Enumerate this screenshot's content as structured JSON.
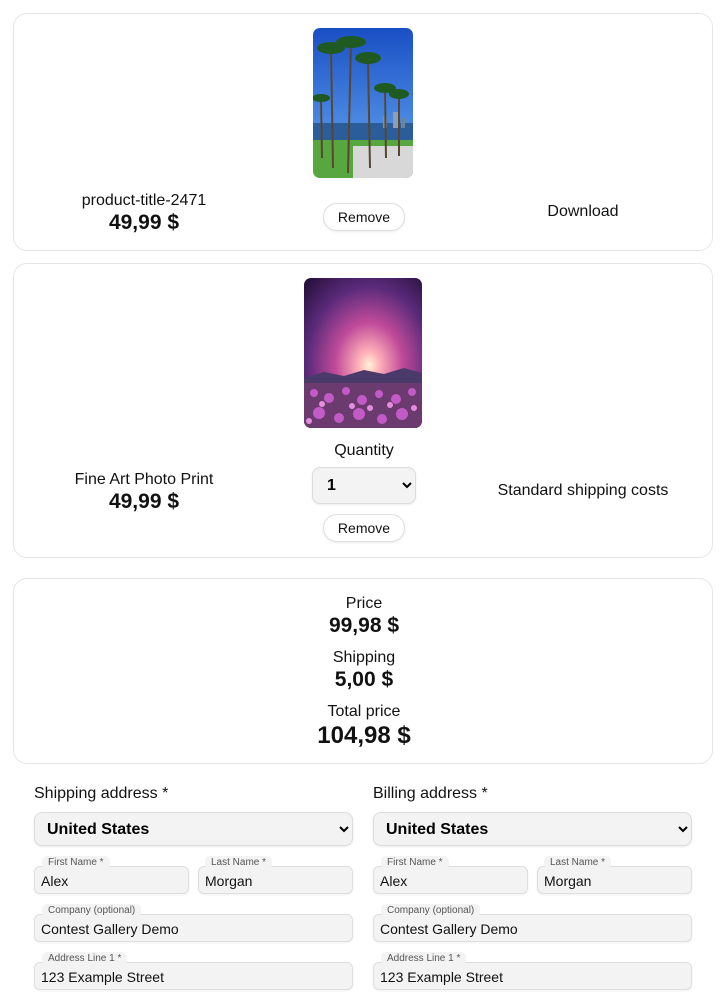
{
  "cart": {
    "items": [
      {
        "title": "product-title-2471",
        "price": "49,99 $",
        "remove_label": "Remove",
        "delivery_label": "Download",
        "image_icon": "palm-trees-photo"
      },
      {
        "title": "Fine Art Photo Print",
        "price": "49,99 $",
        "quantity_label": "Quantity",
        "quantity_value": "1",
        "quantity_options": [
          "1"
        ],
        "remove_label": "Remove",
        "delivery_label": "Standard shipping costs",
        "image_icon": "sunset-flowers-photo"
      }
    ]
  },
  "summary": {
    "price_label": "Price",
    "price_value": "99,98 $",
    "shipping_label": "Shipping",
    "shipping_value": "5,00 $",
    "total_label": "Total price",
    "total_value": "104,98 $"
  },
  "shipping": {
    "heading": "Shipping address *",
    "country": "United States",
    "first_name_label": "First Name *",
    "first_name": "Alex",
    "last_name_label": "Last Name *",
    "last_name": "Morgan",
    "company_label": "Company (optional)",
    "company": "Contest Gallery Demo",
    "address1_label": "Address Line 1 *",
    "address1": "123 Example Street"
  },
  "billing": {
    "heading": "Billing address *",
    "country": "United States",
    "first_name_label": "First Name *",
    "first_name": "Alex",
    "last_name_label": "Last Name *",
    "last_name": "Morgan",
    "company_label": "Company (optional)",
    "company": "Contest Gallery Demo",
    "address1_label": "Address Line 1 *",
    "address1": "123 Example Street"
  },
  "colors": {
    "border": "#e6e6e6",
    "field_bg": "#f3f3f3"
  }
}
